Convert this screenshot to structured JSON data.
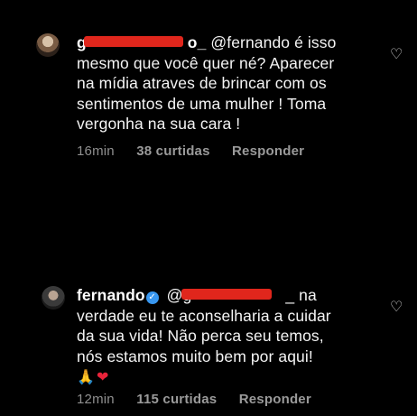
{
  "comments": [
    {
      "username_suffix": "o_",
      "username_visible_prefix": "g",
      "text_lines": [
        "@fernando é isso",
        "mesmo que você quer né? Aparecer",
        "na mídia atraves de brincar com os",
        "sentimentos de uma mulher ! Toma",
        "vergonha na sua cara !"
      ],
      "time": "16min",
      "likes": "38 curtidas",
      "reply_label": "Responder",
      "icons": {
        "avatar": "avatar-icon",
        "like": "heart-outline-icon"
      }
    },
    {
      "username": "fernando",
      "mention_prefix": "@g",
      "mention_suffix": "_",
      "text_first": "na",
      "text_lines": [
        "verdade eu te aconselharia a cuidar",
        "da sua vida! Não perca seu temos,",
        "nós estamos muito bem por aqui!"
      ],
      "emojis": {
        "hands": "🙏",
        "heart": "❤"
      },
      "time": "12min",
      "likes": "115 curtidas",
      "reply_label": "Responder",
      "icons": {
        "avatar": "avatar-icon",
        "verified": "verified-badge-icon",
        "like": "heart-outline-icon"
      }
    }
  ],
  "colors": {
    "background": "#000000",
    "text": "#f4f4f4",
    "meta": "#9a9a9a",
    "verified": "#3897f0",
    "redaction": "#e0261c"
  }
}
